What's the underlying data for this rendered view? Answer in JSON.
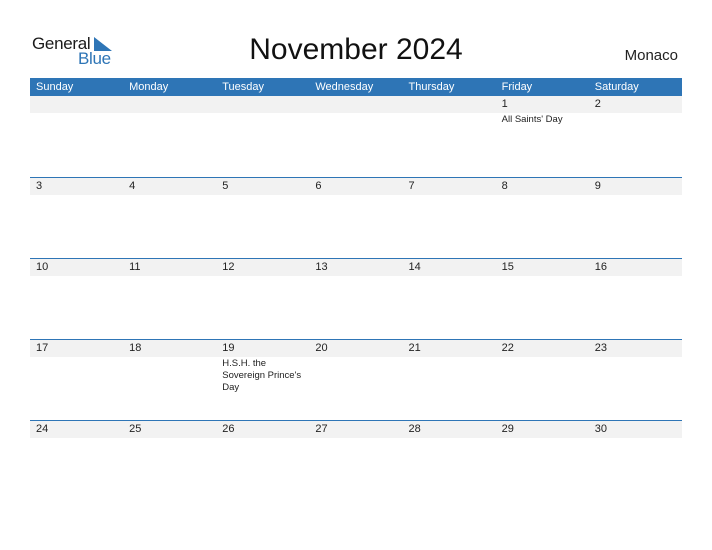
{
  "logo": {
    "word1": "General",
    "word2": "Blue"
  },
  "title": "November 2024",
  "country": "Monaco",
  "colors": {
    "accent": "#2e75b6",
    "strip": "#f2f2f2"
  },
  "weekdays": [
    "Sunday",
    "Monday",
    "Tuesday",
    "Wednesday",
    "Thursday",
    "Friday",
    "Saturday"
  ],
  "weeks": [
    {
      "days": [
        "",
        "",
        "",
        "",
        "",
        "1",
        "2"
      ],
      "events": [
        "",
        "",
        "",
        "",
        "",
        "All Saints' Day",
        ""
      ]
    },
    {
      "days": [
        "3",
        "4",
        "5",
        "6",
        "7",
        "8",
        "9"
      ],
      "events": [
        "",
        "",
        "",
        "",
        "",
        "",
        ""
      ]
    },
    {
      "days": [
        "10",
        "11",
        "12",
        "13",
        "14",
        "15",
        "16"
      ],
      "events": [
        "",
        "",
        "",
        "",
        "",
        "",
        ""
      ]
    },
    {
      "days": [
        "17",
        "18",
        "19",
        "20",
        "21",
        "22",
        "23"
      ],
      "events": [
        "",
        "",
        "H.S.H. the Sovereign Prince's Day",
        "",
        "",
        "",
        ""
      ]
    },
    {
      "days": [
        "24",
        "25",
        "26",
        "27",
        "28",
        "29",
        "30"
      ],
      "events": [
        "",
        "",
        "",
        "",
        "",
        "",
        ""
      ]
    }
  ]
}
